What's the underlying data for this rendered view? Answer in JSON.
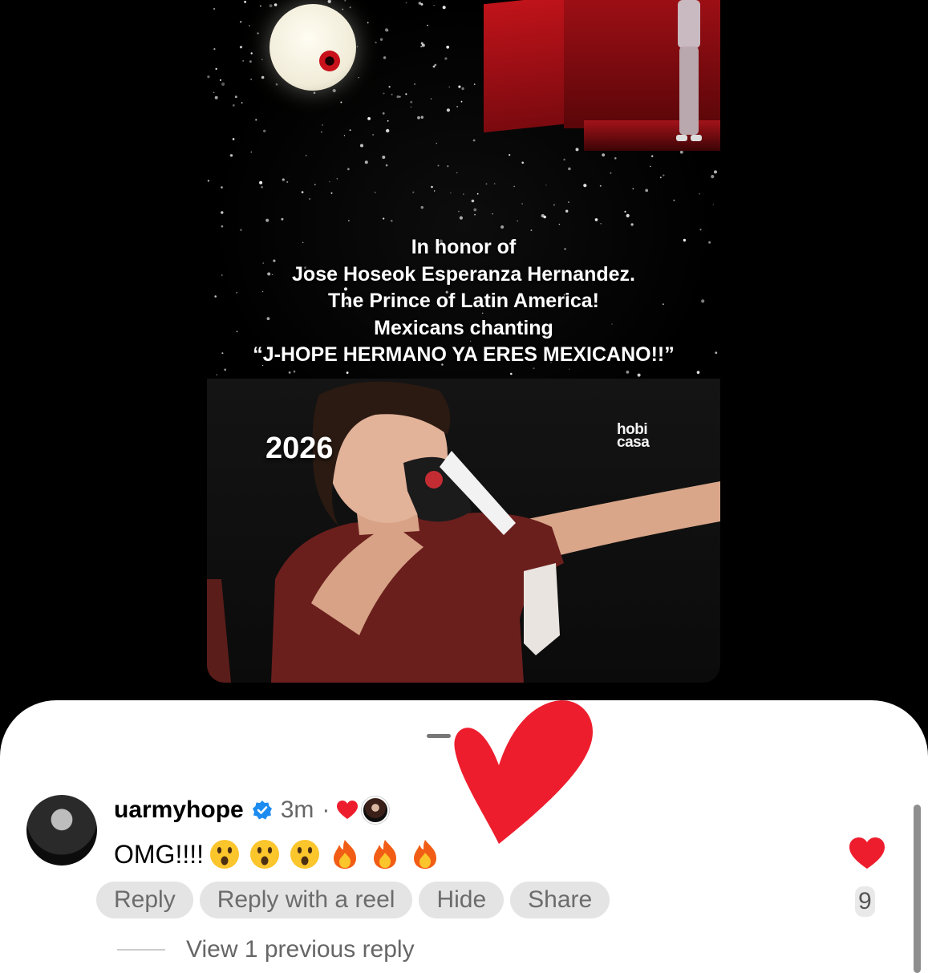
{
  "video": {
    "caption_lines": [
      "In honor of",
      "Jose Hoseok Esperanza Hernandez.",
      "The Prince of Latin America!",
      "Mexicans chanting",
      "“J-HOPE HERMANO YA ERES MEXICANO!!”"
    ],
    "year_label": "2026",
    "watermark_line1": "hobi",
    "watermark_line2": "casa"
  },
  "comment": {
    "username": "uarmyhope",
    "verified_icon": "verified-badge-icon",
    "time_ago": "3m",
    "separator": "·",
    "text": "OMG!!!!",
    "emojis": [
      "astonished-face",
      "astonished-face",
      "astonished-face",
      "fire",
      "fire",
      "fire"
    ],
    "actions": {
      "reply": "Reply",
      "reply_with_reel": "Reply with a reel",
      "hide": "Hide",
      "share": "Share"
    },
    "like_count": "9",
    "view_replies": "View 1 previous reply"
  },
  "colors": {
    "accent_red": "#ee1d2d",
    "verified_blue": "#1d8cf0",
    "chip_bg": "#e4e4e4"
  }
}
